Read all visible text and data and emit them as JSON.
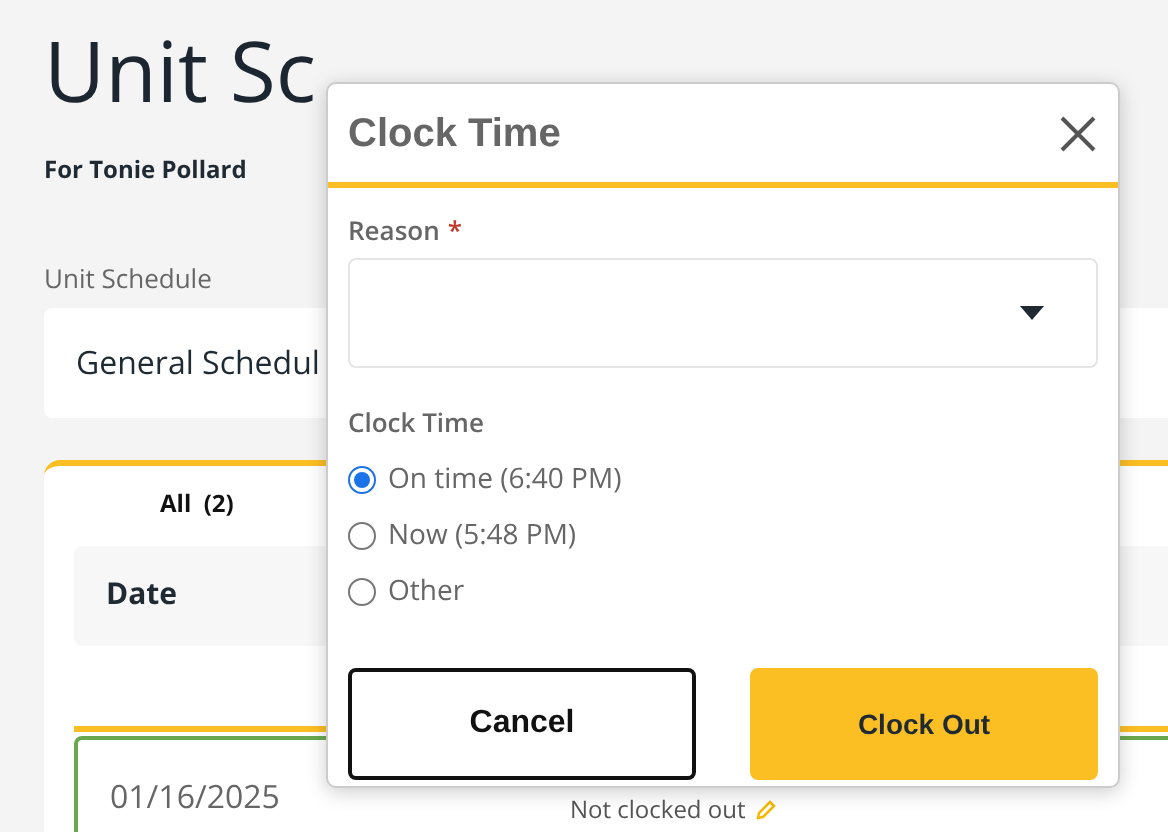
{
  "page": {
    "title": "Unit Sc",
    "subtitle": "For Tonie Pollard",
    "schedule_label": "Unit Schedule",
    "schedule_value": "General Schedul"
  },
  "tabs": [
    {
      "label": "All",
      "count": "(2)",
      "selected": true
    }
  ],
  "table": {
    "columns": [
      "Date"
    ],
    "rows": [
      {
        "date": "01/16/2025",
        "status": "Not clocked out"
      }
    ]
  },
  "dialog": {
    "title": "Clock Time",
    "reason_label": "Reason",
    "required_mark": "*",
    "clock_label": "Clock Time",
    "options": [
      {
        "label": "On time (6:40 PM)",
        "selected": true
      },
      {
        "label": "Now (5:48 PM)",
        "selected": false
      },
      {
        "label": "Other",
        "selected": false
      }
    ],
    "buttons": [
      {
        "label": "Cancel",
        "kind": "secondary"
      },
      {
        "label": "Clock Out",
        "kind": "primary"
      }
    ]
  }
}
